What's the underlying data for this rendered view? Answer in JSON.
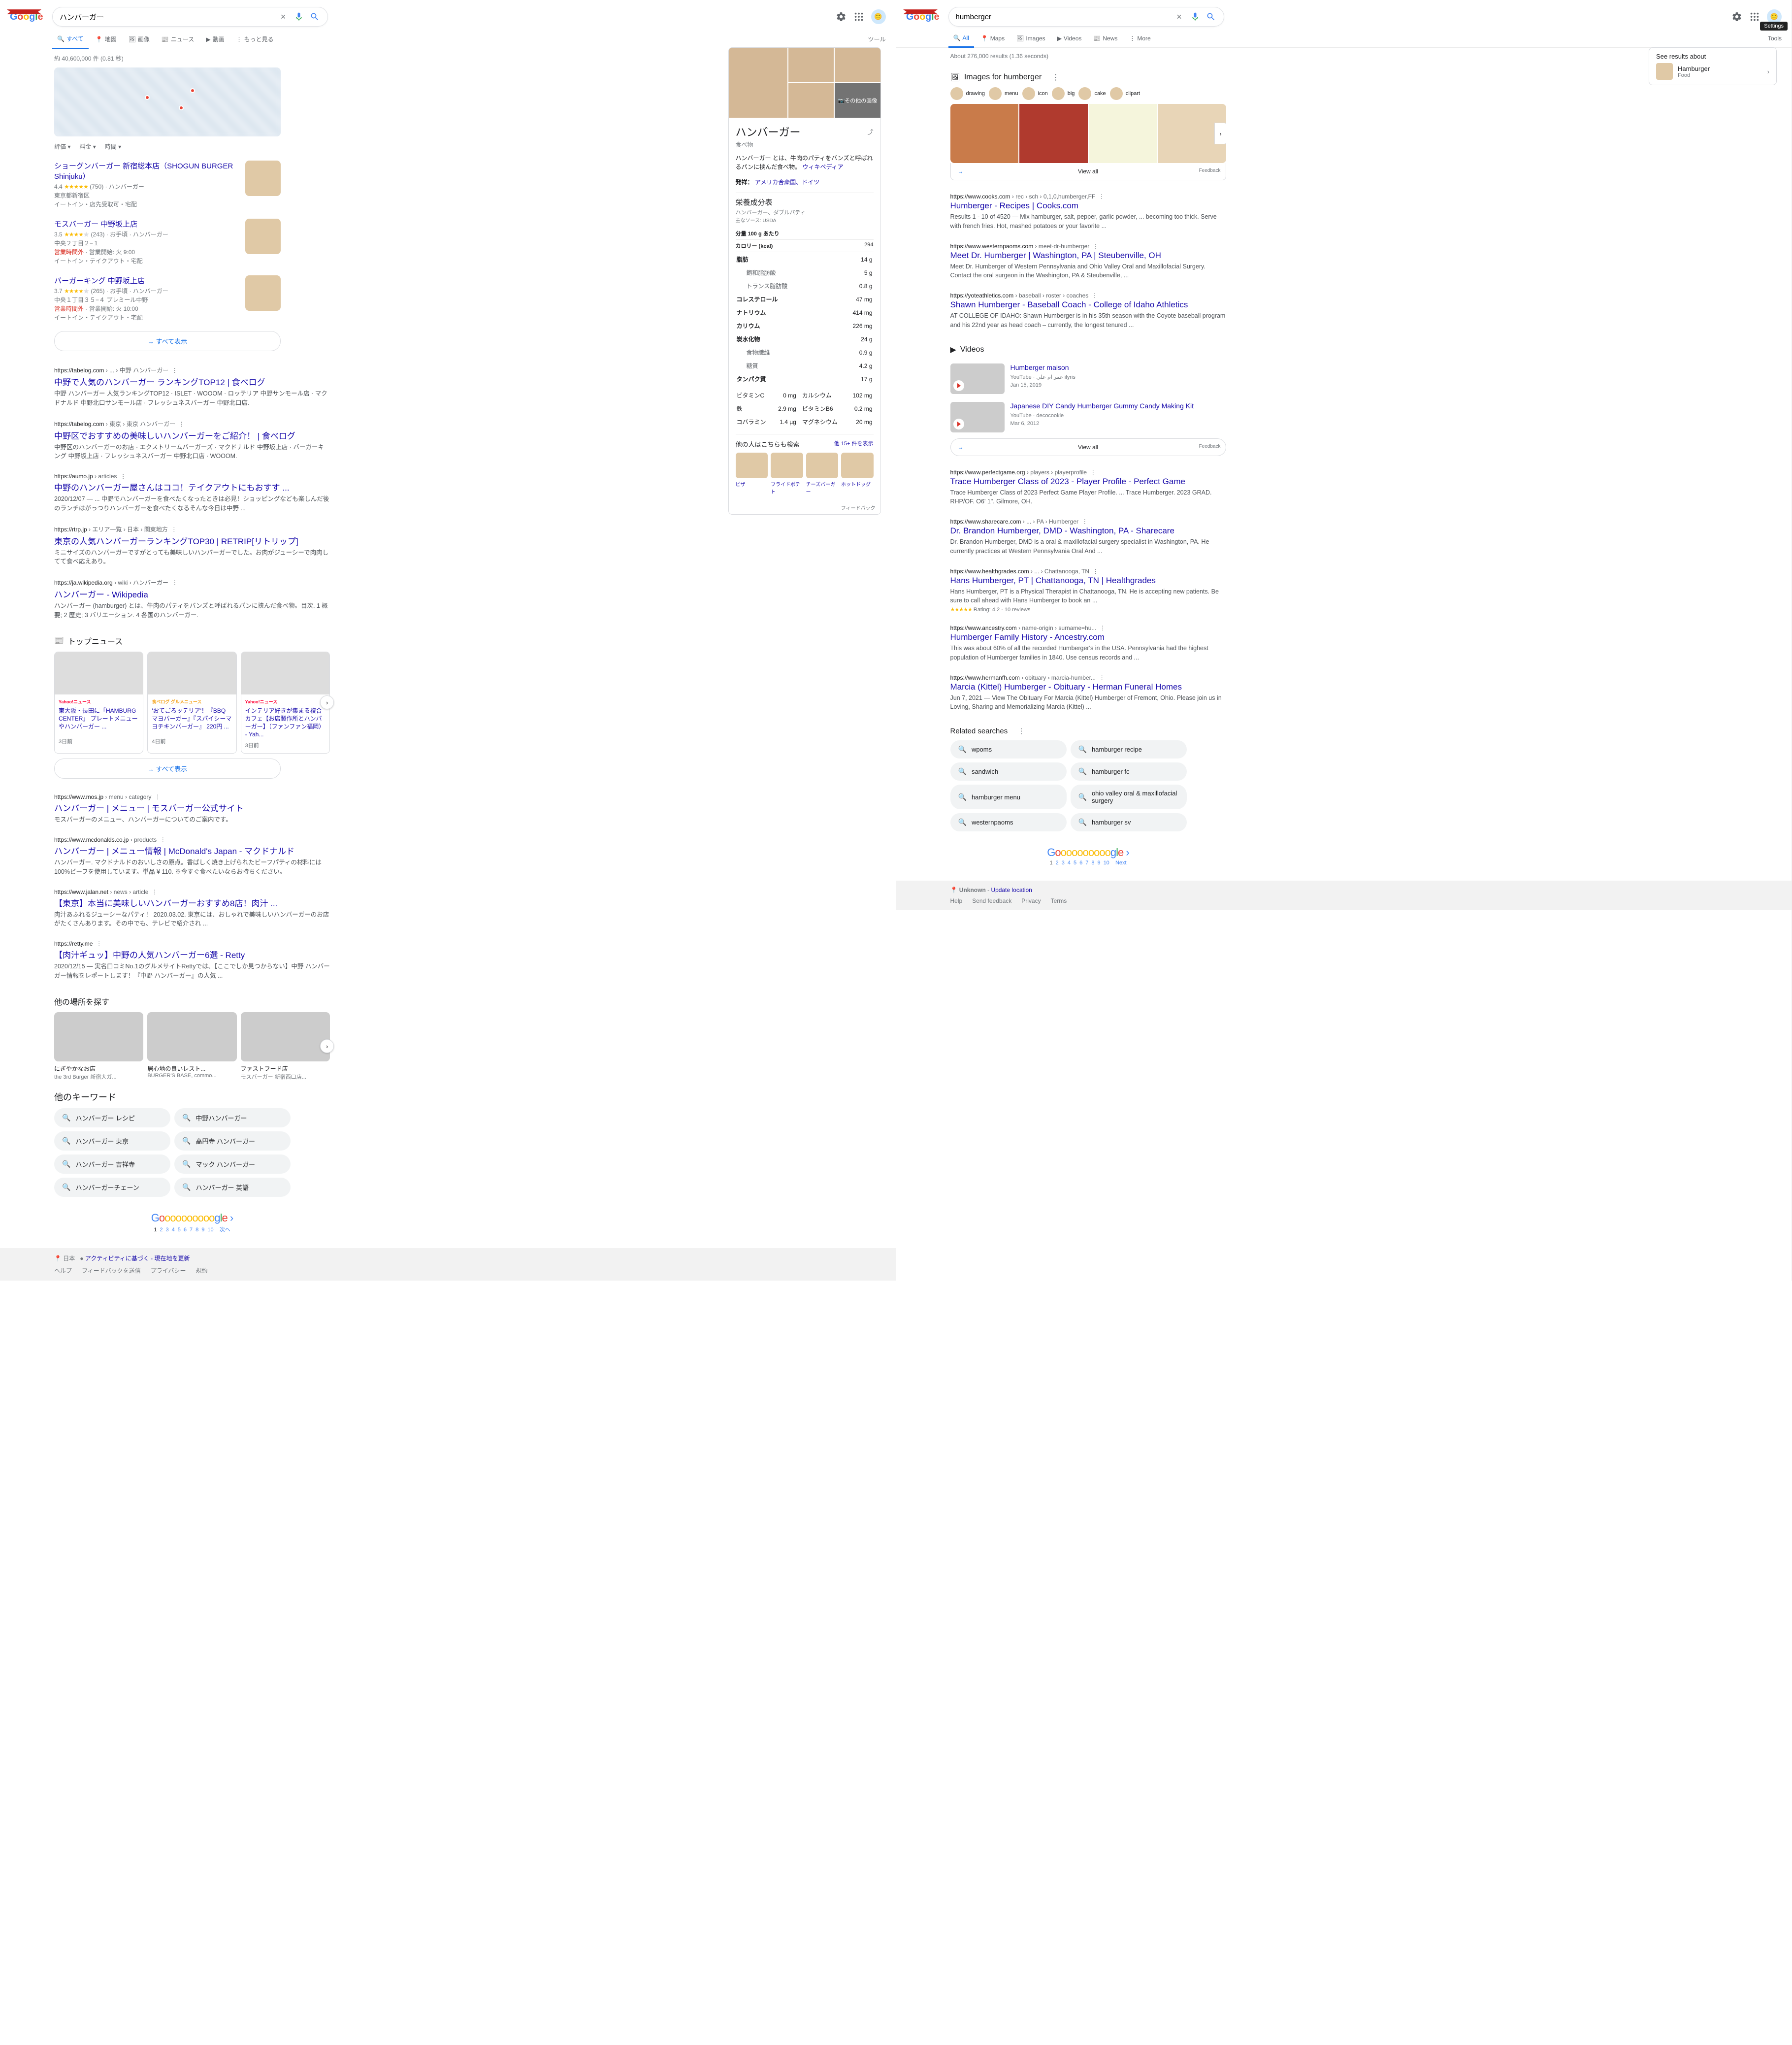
{
  "left": {
    "query": "ハンバーガー",
    "tabs": [
      "すべて",
      "地図",
      "画像",
      "ニュース",
      "動画",
      "もっと見る"
    ],
    "tools": "ツール",
    "stats": "約 40,600,000 件 (0.81 秒)",
    "filters": [
      "評価",
      "料金",
      "時間"
    ],
    "places": [
      {
        "title": "ショーグンバーガー 新宿総本店（SHOGUN BURGER Shinjuku）",
        "rating": "4.4",
        "count": "(750)",
        "genre": "ハンバーガー",
        "addr": "東京都新宿区",
        "meta": "イートイン・店先受取可・宅配"
      },
      {
        "title": "モスバーガー 中野坂上店",
        "rating": "3.5",
        "count": "(243)",
        "cost": "お手頃",
        "genre": "ハンバーガー",
        "addr": "中央２丁目２−１",
        "hoursLabel": "営業時間外",
        "hours": "営業開始: 火 9:00",
        "meta": "イートイン・テイクアウト・宅配"
      },
      {
        "title": "バーガーキング 中野坂上店",
        "rating": "3.7",
        "count": "(265)",
        "cost": "お手頃",
        "genre": "ハンバーガー",
        "addr": "中央１丁目３５−４ プレミール中野",
        "hoursLabel": "営業時間外",
        "hours": "営業開始: 火 10:00",
        "meta": "イートイン・テイクアウト・宅配"
      }
    ],
    "showAll": "すべて表示",
    "results": [
      {
        "cite": "https://tabelog.com › ... › 中野 ハンバーガー",
        "title": "中野で人気のハンバーガー ランキングTOP12 | 食べログ",
        "snip": "中野 ハンバーガー 人気ランキングTOP12 · ISLET · WOOOM · ロッテリア 中野サンモール店 · マクドナルド 中野北口サンモール店 · フレッシュネスバーガー 中野北口店."
      },
      {
        "cite": "https://tabelog.com › 東京 › 東京 ハンバーガー",
        "title": "中野区でおすすめの美味しいハンバーガーをご紹介！ | 食べログ",
        "snip": "中野区のハンバーガーのお店 · エクストリームバーガーズ · マクドナルド 中野坂上店 · バーガーキング 中野坂上店 · フレッシュネスバーガー 中野北口店 · WOOOM."
      },
      {
        "cite": "https://aumo.jp › articles",
        "title": "中野のハンバーガー屋さんはココ！テイクアウトにもおすす ...",
        "snip": "2020/12/07 — ... 中野でハンバーガーを食べたくなったときは必見！ショッピングなども楽しんだ後のランチはがっつりハンバーガーを食べたくなるそんな今日は中野 ..."
      },
      {
        "cite": "https://rtrp.jp › エリア一覧 › 日本 › 関東地方",
        "title": "東京の人気ハンバーガーランキングTOP30 | RETRIP[リトリップ]",
        "snip": "ミニサイズのハンバーガーですがとっても美味しいハンバーガーでした。お肉がジューシーで肉肉してて食べ応えあり。"
      },
      {
        "cite": "https://ja.wikipedia.org › wiki › ハンバーガー",
        "title": "ハンバーガー - Wikipedia",
        "snip": "ハンバーガー (hamburger) とは、牛肉のパティをバンズと呼ばれるパンに挟んだ食べ物。目次. 1 概要; 2 歴史; 3 バリエーション. 4 各国のハンバーガー."
      }
    ],
    "newsHeader": "トップニュース",
    "news": [
      {
        "src": "Yahoo!ニュース",
        "srcColor": "#ff0033",
        "title": "東大阪・長田に「HAMBURG CENTER」 プレートメニューやハンバーガー ...",
        "ago": "3日前"
      },
      {
        "src": "食べログ グルメニュース",
        "srcColor": "#f5a623",
        "title": "'おてごろッテリア'！『BBQ マヨバーガー』『スパイシーマヨチキンバーガー』 220円 ...",
        "ago": "4日前"
      },
      {
        "src": "Yahoo!ニュース",
        "srcColor": "#ff0033",
        "title": "インテリア好きが集まる複合カフェ【お店製作所とハンバーガー】（ファンファン福岡） - Yah...",
        "ago": "3日前"
      }
    ],
    "results2": [
      {
        "cite": "https://www.mos.jp › menu › category",
        "title": "ハンバーガー | メニュー | モスバーガー公式サイト",
        "snip": "モスバーガーのメニュー、ハンバーガーについてのご案内です。"
      },
      {
        "cite": "https://www.mcdonalds.co.jp › products",
        "title": "ハンバーガー | メニュー情報 | McDonald's Japan - マクドナルド",
        "snip": "ハンバーガー. マクドナルドのおいしさの原点。香ばしく焼き上げられたビーフパティの材料には100%ビーフを使用しています。単品 ¥ 110. ※今すぐ食べたいならお持ちください。"
      },
      {
        "cite": "https://www.jalan.net › news › article",
        "title": "【東京】本当に美味しいハンバーガーおすすめ8店！肉汁 ...",
        "snip": "肉汁あふれるジューシーなパティ！ 2020.03.02. 東京には、おしゃれで美味しいハンバーガーのお店がたくさんあります。その中でも、テレビで紹介され ..."
      },
      {
        "cite": "https://retty.me",
        "title": "【肉汁ギュッ】中野の人気ハンバーガー6選 - Retty",
        "snip": "2020/12/15 — 実名口コミNo.1のグルメサイトRettyでは、【ここでしか見つからない】中野 ハンバーガー情報をレポートします！『中野 ハンバーガー』の人気 ..."
      }
    ],
    "explore": "他の場所を探す",
    "exploreItems": [
      {
        "t": "にぎやかなお店",
        "s": "the 3rd Burger 新宿大ガ..."
      },
      {
        "t": "居心地の良いレスト...",
        "s": "BURGER'S BASE, commo..."
      },
      {
        "t": "ファストフード店",
        "s": "モスバーガー 新宿西口店..."
      }
    ],
    "relatedTitle": "他のキーワード",
    "related": [
      "ハンバーガー レシピ",
      "中野ハンバーガー",
      "ハンバーガー 東京",
      "高円寺 ハンバーガー",
      "ハンバーガー 吉祥寺",
      "マック ハンバーガー",
      "ハンバーガーチェーン",
      "ハンバーガー 英語"
    ],
    "nextLabel": "次へ",
    "footer": {
      "loc": [
        "日本",
        "アクティビティに基づく - 現在地を更新"
      ],
      "links": [
        "ヘルプ",
        "フィードバックを送信",
        "プライバシー",
        "規約"
      ]
    },
    "knowledge": {
      "title": "ハンバーガー",
      "sub": "食べ物",
      "share": "共有",
      "moreImages": "その他の画像",
      "desc": "ハンバーガー とは、牛肉のパティをバンズと呼ばれるパンに挟んだ食べ物。",
      "wiki": "ウィキペディア",
      "origin": {
        "lbl": "発祥：",
        "val": "アメリカ合衆国、ドイツ"
      },
      "nutHead": "栄養成分表",
      "nutSub": "ハンバーガー、ダブルパティ",
      "nutSource": "主なソース: USDA",
      "per": "分量 100 g あたり",
      "cal": {
        "lbl": "カロリー (kcal)",
        "val": "294"
      },
      "rows": [
        {
          "k": "脂肪",
          "v": "14 g"
        },
        {
          "k": "飽和脂肪酸",
          "v": "5 g",
          "indent": true
        },
        {
          "k": "トランス脂肪酸",
          "v": "0.8 g",
          "indent": true
        },
        {
          "k": "コレステロール",
          "v": "47 mg"
        },
        {
          "k": "ナトリウム",
          "v": "414 mg"
        },
        {
          "k": "カリウム",
          "v": "226 mg"
        },
        {
          "k": "炭水化物",
          "v": "24 g"
        },
        {
          "k": "食物繊維",
          "v": "0.9 g",
          "indent": true
        },
        {
          "k": "糖質",
          "v": "4.2 g",
          "indent": true
        },
        {
          "k": "タンパク質",
          "v": "17 g"
        }
      ],
      "mintable": [
        [
          "ビタミンC",
          "0 mg",
          "カルシウム",
          "102 mg"
        ],
        [
          "鉄",
          "2.9 mg",
          "ビタミンB6",
          "0.2 mg"
        ],
        [
          "コバラミン",
          "1.4 µg",
          "マグネシウム",
          "20 mg"
        ]
      ],
      "alsoTitle": "他の人はこちらも検索",
      "alsoMore": "他 15+ 件を表示",
      "also": [
        "ピザ",
        "フライドポテト",
        "チーズバーガー",
        "ホットドッグ"
      ],
      "feedback": "フィードバック"
    }
  },
  "right": {
    "query": "humberger",
    "tooltipSettings": "Settings",
    "tabs": [
      "All",
      "Maps",
      "Images",
      "Videos",
      "News",
      "More"
    ],
    "tools": "Tools",
    "stats": "About 276,000 results (1.36 seconds)",
    "seeResults": {
      "head": "See results about",
      "t": "Hamburger",
      "s": "Food"
    },
    "imagesFor": "Images for humberger",
    "imgChips": [
      "drawing",
      "menu",
      "icon",
      "big",
      "cake",
      "clipart"
    ],
    "viewAll": "View all",
    "feedback": "Feedback",
    "results": [
      {
        "cite": "https://www.cooks.com › rec › sch › 0,1,0,humberger,FF",
        "title": "Humberger - Recipes | Cooks.com",
        "snip": "Results 1 - 10 of 4520 — Mix hamburger, salt, pepper, garlic powder, ... becoming too thick. Serve with french fries. Hot, mashed potatoes or your favorite ..."
      },
      {
        "cite": "https://www.westernpaoms.com › meet-dr-humberger",
        "title": "Meet Dr. Humberger | Washington, PA | Steubenville, OH",
        "snip": "Meet Dr. Humberger of Western Pennsylvania and Ohio Valley Oral and Maxillofacial Surgery. Contact the oral surgeon in the Washington, PA & Steubenville, ..."
      },
      {
        "cite": "https://yoteathletics.com › baseball › roster › coaches",
        "title": "Shawn Humberger - Baseball Coach - College of Idaho Athletics",
        "snip": "AT COLLEGE OF IDAHO: Shawn Humberger is in his 35th season with the Coyote baseball program and his 22nd year as head coach – currently, the longest tenured ..."
      }
    ],
    "videosHeader": "Videos",
    "videos": [
      {
        "title": "Humberger maison",
        "src": "YouTube · ‎ام علي‎ عمر ilyris",
        "date": "Jan 15, 2019"
      },
      {
        "title": "Japanese DIY Candy Humberger Gummy Candy Making Kit",
        "src": "YouTube · decocookie",
        "date": "Mar 6, 2012"
      }
    ],
    "results2": [
      {
        "cite": "https://www.perfectgame.org › players › playerprofile",
        "title": "Trace Humberger Class of 2023 - Player Profile - Perfect Game",
        "snip": "Trace Humberger Class of 2023 Perfect Game Player Profile. ... Trace Humberger. 2023 GRAD. RHP/OF. O6' 1\". Gilmore, OH."
      },
      {
        "cite": "https://www.sharecare.com › ... › PA › Humberger",
        "title": "Dr. Brandon Humberger, DMD - Washington, PA - Sharecare",
        "snip": "Dr. Brandon Humberger, DMD is a oral & maxillofacial surgery specialist in Washington, PA. He currently practices at Western Pennsylvania Oral And ..."
      },
      {
        "cite": "https://www.healthgrades.com › ... › Chattanooga, TN",
        "title": "Hans Humberger, PT | Chattanooga, TN | Healthgrades",
        "snip": "Hans Humberger, PT is a Physical Therapist in Chattanooga, TN. He is accepting new patients. Be sure to call ahead with Hans Humberger to book an ...",
        "rating": "★★★★★ Rating: 4.2 · 10 reviews"
      },
      {
        "cite": "https://www.ancestry.com › name-origin › surname=hu...",
        "title": "Humberger Family History - Ancestry.com",
        "snip": "This was about 60% of all the recorded Humberger's in the USA. Pennsylvania had the highest population of Humberger families in 1840. Use census records and ..."
      },
      {
        "cite": "https://www.hermanfh.com › obituary › marcia-humber...",
        "title": "Marcia (Kittel) Humberger - Obituary - Herman Funeral Homes",
        "snip": "Jun 7, 2021 — View The Obituary For Marcia (Kittel) Humberger of Fremont, Ohio. Please join us in Loving, Sharing and Memorializing Marcia (Kittel) ..."
      }
    ],
    "relatedTitle": "Related searches",
    "related": [
      "wpoms",
      "hamburger recipe",
      "sandwich",
      "hamburger fc",
      "hamburger menu",
      "ohio valley oral & maxillofacial surgery",
      "westernpaoms",
      "hamburger sv"
    ],
    "nextLabel": "Next",
    "footer": {
      "loc": [
        "Unknown",
        "Update location"
      ],
      "links": [
        "Help",
        "Send feedback",
        "Privacy",
        "Terms"
      ]
    }
  }
}
